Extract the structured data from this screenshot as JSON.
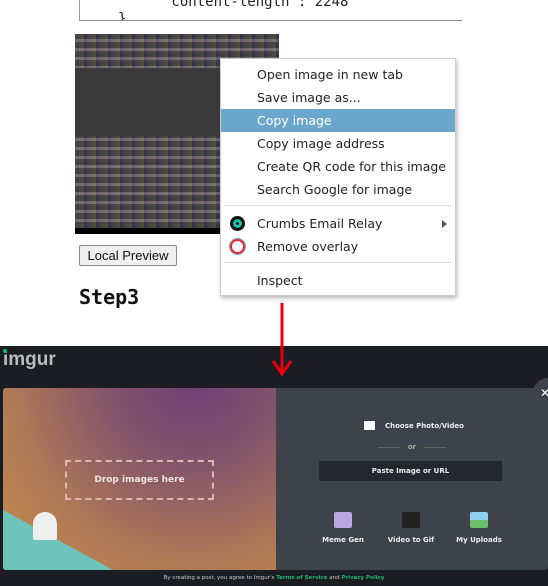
{
  "code": {
    "line1": "\"content-length\": 2248",
    "line2": "}"
  },
  "local_preview_label": "Local Preview",
  "step_heading": "Step3",
  "context_menu": {
    "items": [
      {
        "label": "Open image in new tab"
      },
      {
        "label": "Save image as..."
      },
      {
        "label": "Copy image",
        "highlighted": true
      },
      {
        "label": "Copy image address"
      },
      {
        "label": "Create QR code for this image"
      },
      {
        "label": "Search Google for image"
      },
      {
        "label": "Crumbs Email Relay",
        "icon": "crumbs-icon",
        "submenu": true
      },
      {
        "label": "Remove overlay",
        "icon": "no-entry-icon"
      },
      {
        "label": "Inspect"
      }
    ],
    "highlight_color": "#6ba7cd"
  },
  "imgur": {
    "logo": "imgur",
    "drop_label": "Drop images here",
    "choose_label": "Choose Photo/Video",
    "or_label": "or",
    "paste_label": "Paste Image or URL",
    "tools": [
      {
        "label": "Meme Gen"
      },
      {
        "label": "Video to Gif"
      },
      {
        "label": "My Uploads"
      }
    ],
    "close": "✕",
    "footer": {
      "prefix": "By creating a post, you agree to Imgur's",
      "terms": "Terms of Service",
      "and": "and",
      "privacy": "Privacy Policy"
    },
    "accent": "#1bb76e"
  },
  "annotation_color": "#e8000b"
}
